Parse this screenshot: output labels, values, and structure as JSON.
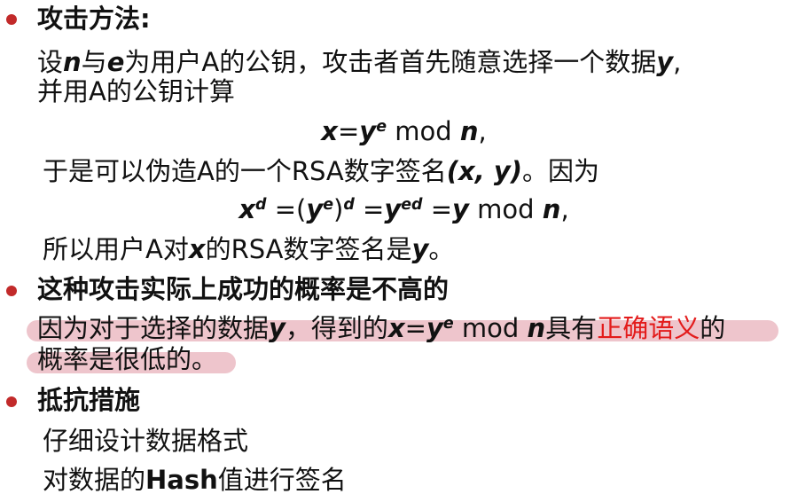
{
  "colors": {
    "bullet": "#c22a2a",
    "highlight": "#cd5a6e",
    "emphasis": "#e31b1b"
  },
  "bullets": {
    "method_title": "攻击方法:",
    "success_title": "这种攻击实际上成功的概率是不高的",
    "counter_title": "抵抗措施"
  },
  "method": {
    "l1_a": "设",
    "n": "n",
    "l1_b": "与",
    "e": "e",
    "l1_c": "为用户A的公钥，攻击者首先随意选择一个数据",
    "y": "y",
    "l1_d": ",",
    "l2": "并用A的公钥计算",
    "f1_x": "x",
    "f1_eq": "=",
    "f1_y": "y",
    "f1_sup": "e",
    "f1_mod": " mod ",
    "f1_n": "n",
    "f1_end": ",",
    "l3_a": "于是可以伪造A的一个RSA数字签名",
    "l3_pair": "(x, y)",
    "l3_b": "。因为",
    "f2_x": "x",
    "f2_d1": "d",
    "f2_p1": " =(",
    "f2_y1": "y",
    "f2_e1": "e",
    "f2_p2": ")",
    "f2_d2": "d",
    "f2_p3": " =",
    "f2_y2": "y",
    "f2_ed": "ed",
    "f2_p4": " =",
    "f2_y3": "y",
    "f2_mod": " mod ",
    "f2_n": "n",
    "f2_end": ",",
    "l4_a": "所以用户A对",
    "l4_x": "x",
    "l4_b": "的RSA数字签名是",
    "l4_y": "y",
    "l4_c": "。"
  },
  "success": {
    "l1_a": "因为对于选择的数据",
    "y": "y",
    "l1_b": "，得到的",
    "x": "x",
    "eq": "=",
    "y2": "y",
    "sup": "e",
    "mod": " mod ",
    "n": "n",
    "l1_c": "具有",
    "red": "正确语义",
    "l1_d": "的",
    "l2": "概率是很低的。"
  },
  "counter": {
    "item1": "仔细设计数据格式",
    "item2_a": "对数据的",
    "item2_hash": "Hash",
    "item2_b": "值进行签名"
  }
}
